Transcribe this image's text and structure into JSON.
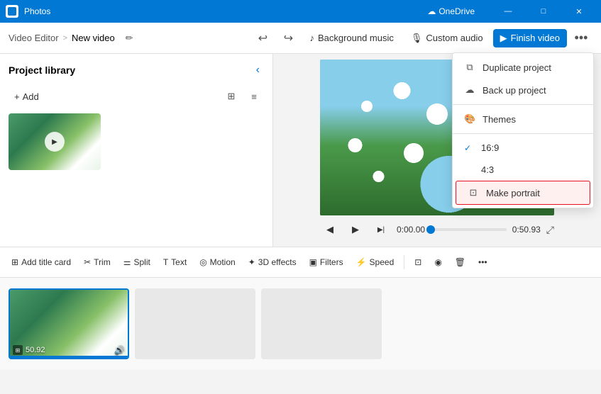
{
  "titleBar": {
    "appName": "Photos",
    "cloudLabel": "OneDrive",
    "minBtn": "—",
    "maxBtn": "□",
    "closeBtn": "✕"
  },
  "toolbar": {
    "breadcrumb": {
      "parent": "Video Editor",
      "separator": ">",
      "current": "New video"
    },
    "undoLabel": "↩",
    "redoLabel": "↪",
    "backgroundMusicLabel": "Background music",
    "customAudioLabel": "Custom audio",
    "finishVideoLabel": "Finish video",
    "moreLabel": "•••"
  },
  "sidebar": {
    "title": "Project library",
    "collapseBtn": "‹",
    "addLabel": "+ Add"
  },
  "preview": {
    "timeStart": "0:00.00",
    "timeEnd": "0:50.93",
    "prevBtn": "◀",
    "playBtn": "▶",
    "nextBtn": "▶|"
  },
  "bottomToolbar": {
    "items": [
      {
        "id": "add-title-card",
        "icon": "⊞",
        "label": "Add title card"
      },
      {
        "id": "trim",
        "icon": "✂",
        "label": "Trim"
      },
      {
        "id": "split",
        "icon": "⚌",
        "label": "Split"
      },
      {
        "id": "text",
        "icon": "T",
        "label": "Text"
      },
      {
        "id": "motion",
        "icon": "◎",
        "label": "Motion"
      },
      {
        "id": "3d-effects",
        "icon": "✦",
        "label": "3D effects"
      },
      {
        "id": "filters",
        "icon": "▣",
        "label": "Filters"
      },
      {
        "id": "speed",
        "icon": "⚡",
        "label": "Speed"
      },
      {
        "id": "crop",
        "icon": "⊡",
        "label": "Crop"
      },
      {
        "id": "stabilize",
        "icon": "◉",
        "label": "Stabilize"
      },
      {
        "id": "delete",
        "icon": "🗑",
        "label": "Delete"
      },
      {
        "id": "more",
        "icon": "•••",
        "label": ""
      }
    ]
  },
  "timeline": {
    "clips": [
      {
        "id": "clip1",
        "duration": "50.92",
        "active": true,
        "hasAudio": true
      },
      {
        "id": "clip2",
        "active": false
      },
      {
        "id": "clip3",
        "active": false
      }
    ]
  },
  "dropdownMenu": {
    "items": [
      {
        "id": "duplicate",
        "icon": "⧉",
        "label": "Duplicate project",
        "check": ""
      },
      {
        "id": "backup",
        "icon": "☁",
        "label": "Back up project",
        "check": ""
      },
      {
        "id": "themes",
        "icon": "🎨",
        "label": "Themes",
        "check": ""
      },
      {
        "id": "ratio-16-9",
        "icon": "",
        "label": "16:9",
        "check": "✓"
      },
      {
        "id": "ratio-4-3",
        "icon": "",
        "label": "4:3",
        "check": ""
      },
      {
        "id": "make-portrait",
        "icon": "⊡",
        "label": "Make portrait",
        "check": "",
        "highlighted": true
      }
    ]
  }
}
